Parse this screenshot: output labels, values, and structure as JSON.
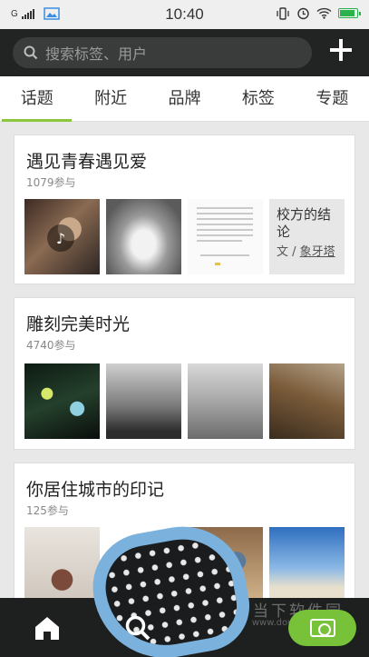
{
  "statusbar": {
    "carrier": "G",
    "time": "10:40"
  },
  "header": {
    "search_placeholder": "搜索标签、用户"
  },
  "tabs": [
    {
      "label": "话题",
      "active": true
    },
    {
      "label": "附近",
      "active": false
    },
    {
      "label": "品牌",
      "active": false
    },
    {
      "label": "标签",
      "active": false
    },
    {
      "label": "专题",
      "active": false
    }
  ],
  "topics": [
    {
      "title": "遇见青春遇见爱",
      "count": "1079参与",
      "text_card": {
        "title": "校方的结论",
        "author_prefix": "文 / ",
        "author": "象牙塔"
      }
    },
    {
      "title": "雕刻完美时光",
      "count": "4740参与"
    },
    {
      "title": "你居住城市的印记",
      "count": "125参与"
    }
  ],
  "watermark": {
    "text": "当下软件园",
    "url": "www.downxia.com"
  },
  "colors": {
    "accent": "#8cc63f",
    "header_bg": "#222424",
    "camera_button": "#78c23a"
  }
}
